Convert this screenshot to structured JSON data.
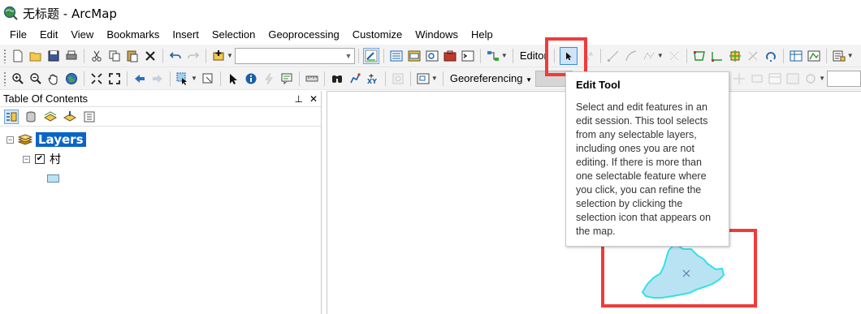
{
  "window": {
    "title": "无标题 - ArcMap"
  },
  "menu": [
    "File",
    "Edit",
    "View",
    "Bookmarks",
    "Insert",
    "Selection",
    "Geoprocessing",
    "Customize",
    "Windows",
    "Help"
  ],
  "toolbar": {
    "editor_label": "Editor",
    "georeferencing_label": "Georeferencing",
    "scale_value": "",
    "layer_combo_value": ""
  },
  "toc": {
    "title": "Table Of Contents",
    "pin_glyph": "⊥",
    "close_glyph": "✕",
    "root_label": "Layers",
    "layers": [
      {
        "name": "村",
        "checked": true,
        "fill_color": "#b9e3f2"
      }
    ]
  },
  "tooltip": {
    "title": "Edit Tool",
    "body": "Select and edit features in an edit session. This tool selects from any selectable layers, including ones you are not editing. If there is more than one selectable feature where you click, you can refine the selection by clicking the selection icon that appears on the map."
  },
  "colors": {
    "highlight": "#f03b3b",
    "feature_fill": "#b9e3f2",
    "feature_outline": "#34e0e6",
    "selection_blue": "#0a64c8"
  }
}
